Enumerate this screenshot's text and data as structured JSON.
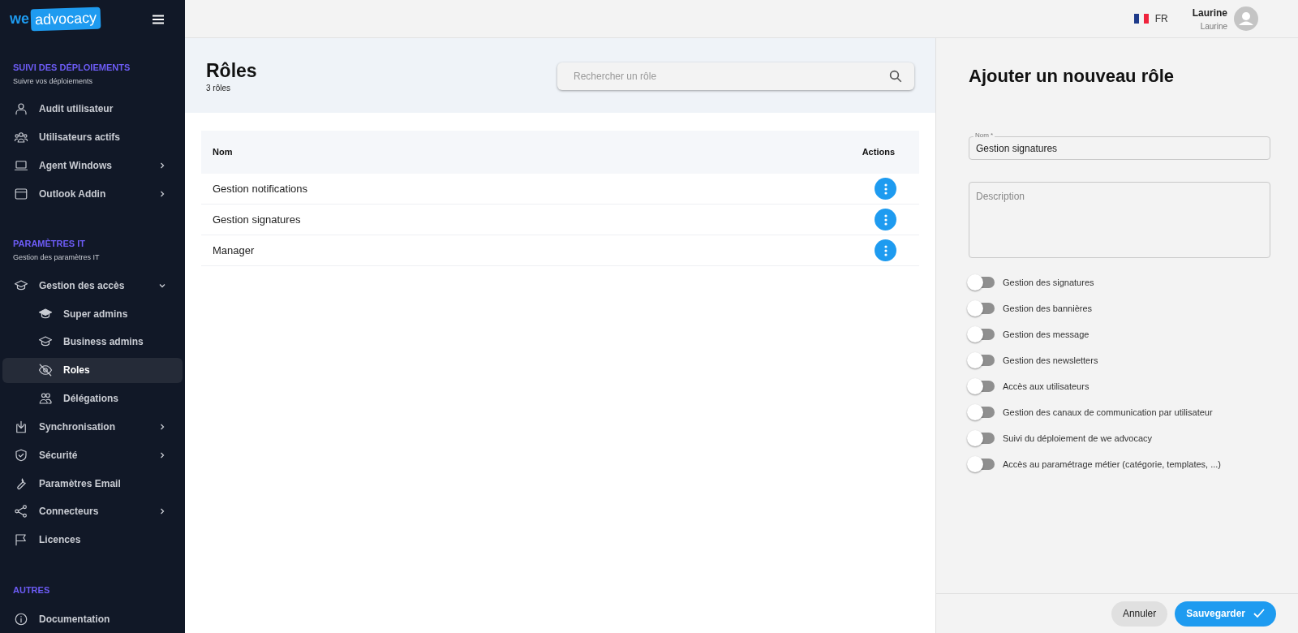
{
  "logo": {
    "part_1": "we",
    "part_2": "advocacy"
  },
  "sidebar": {
    "sections": [
      {
        "title": "SUIVI DES DÉPLOIEMENTS",
        "subtitle": "Suivre vos déploiements",
        "items": [
          {
            "label": "Audit utilisateur",
            "selected": false
          },
          {
            "label": "Utilisateurs actifs",
            "selected": false
          },
          {
            "label": "Agent Windows",
            "selected": false,
            "expanded": false
          },
          {
            "label": "Outlook Addin",
            "selected": false,
            "expanded": false
          }
        ]
      },
      {
        "title": "PARAMÈTRES IT",
        "subtitle": "Gestion des paramètres IT",
        "items": [
          {
            "label": "Gestion des accès",
            "selected": false,
            "expanded": true,
            "children": [
              {
                "label": "Super admins",
                "selected": false
              },
              {
                "label": "Business admins",
                "selected": false
              },
              {
                "label": "Roles",
                "selected": true
              },
              {
                "label": "Délégations",
                "selected": false
              }
            ]
          },
          {
            "label": "Synchronisation",
            "selected": false,
            "expanded": false
          },
          {
            "label": "Sécurité",
            "selected": false,
            "expanded": false
          },
          {
            "label": "Paramètres Email",
            "selected": false
          },
          {
            "label": "Connecteurs",
            "selected": false,
            "expanded": false
          },
          {
            "label": "Licences",
            "selected": false
          }
        ]
      },
      {
        "title": "AUTRES",
        "items": [
          {
            "label": "Documentation",
            "selected": false
          }
        ]
      }
    ]
  },
  "topbar": {
    "language": "FR",
    "user": {
      "name": "Laurine",
      "subtitle": "Laurine"
    }
  },
  "page": {
    "title": "Rôles",
    "count": "3 rôles",
    "search": {
      "placeholder": "Rechercher un rôle"
    }
  },
  "table": {
    "columns": [
      "Nom",
      "Actions"
    ],
    "rows": [
      {
        "name": "Gestion notifications"
      },
      {
        "name": "Gestion signatures"
      },
      {
        "name": "Manager"
      }
    ]
  },
  "panel": {
    "title": "Ajouter un nouveau rôle",
    "name_field": {
      "label": "Nom *",
      "value": "Gestion signatures"
    },
    "description_field": {
      "placeholder": "Description"
    },
    "permissions": [
      {
        "label": "Gestion des signatures",
        "on": false
      },
      {
        "label": "Gestion des bannières",
        "on": false
      },
      {
        "label": "Gestion des message",
        "on": false
      },
      {
        "label": "Gestion des newsletters",
        "on": false
      },
      {
        "label": "Accès aux utilisateurs",
        "on": false
      },
      {
        "label": "Gestion des canaux de communication par utilisateur",
        "on": false
      },
      {
        "label": "Suivi du déploiement de we advocacy",
        "on": false
      },
      {
        "label": "Accès au paramétrage métier (catégorie, templates, ...)",
        "on": false
      }
    ],
    "buttons": {
      "cancel": "Annuler",
      "save": "Sauvegarder"
    }
  }
}
